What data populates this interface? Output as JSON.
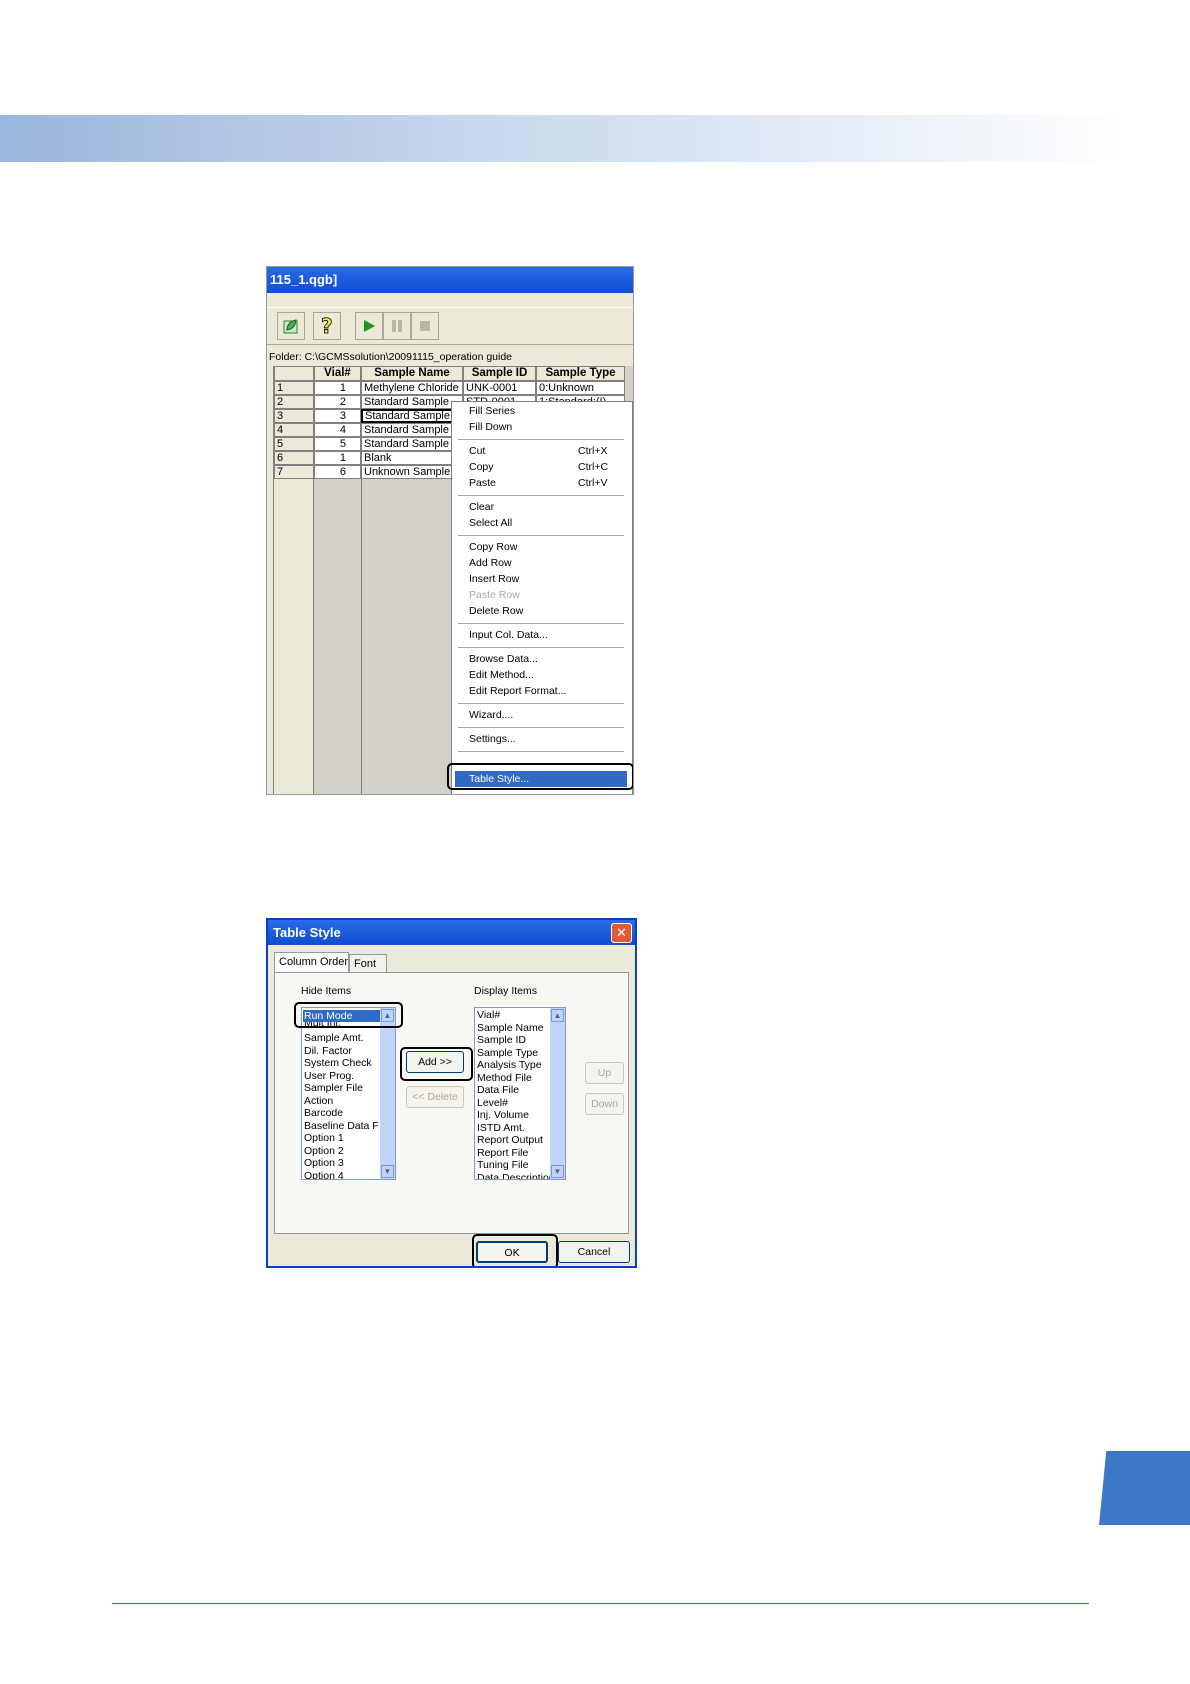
{
  "window": {
    "title": "115_1.qgb]",
    "folder": "Folder: C:\\GCMSsolution\\20091115_operation guide"
  },
  "toolbar": {
    "icons": [
      "leaf-icon",
      "help-icon",
      "play-icon",
      "pause-icon",
      "stop-icon"
    ]
  },
  "table": {
    "headers": [
      "",
      "Vial#",
      "Sample Name",
      "Sample ID",
      "Sample Type"
    ],
    "rows": [
      [
        "1",
        "1",
        "Methylene Chloride",
        "UNK-0001",
        "0:Unknown"
      ],
      [
        "2",
        "2",
        "Standard Sample",
        "STD-0001",
        "1:Standard:(I)"
      ],
      [
        "3",
        "3",
        "Standard Sample",
        "",
        ""
      ],
      [
        "4",
        "4",
        "Standard Sample",
        "",
        ""
      ],
      [
        "5",
        "5",
        "Standard Sample",
        "",
        ""
      ],
      [
        "6",
        "1",
        "Blank",
        "",
        ""
      ],
      [
        "7",
        "6",
        "Unknown Sample",
        "",
        ""
      ]
    ]
  },
  "context_menu": {
    "fill_series": "Fill Series",
    "fill_down": "Fill Down",
    "cut": "Cut",
    "cut_sc": "Ctrl+X",
    "copy": "Copy",
    "copy_sc": "Ctrl+C",
    "paste": "Paste",
    "paste_sc": "Ctrl+V",
    "clear": "Clear",
    "select_all": "Select All",
    "copy_row": "Copy Row",
    "add_row": "Add Row",
    "insert_row": "Insert Row",
    "paste_row": "Paste Row",
    "delete_row": "Delete Row",
    "input_col": "Input Col. Data...",
    "browse_data": "Browse Data...",
    "edit_method": "Edit Method...",
    "edit_report": "Edit Report Format...",
    "wizard": "Wizard....",
    "settings": "Settings...",
    "table_style": "Table Style..."
  },
  "dialog": {
    "title": "Table Style",
    "close": "✕",
    "tab_column_order": "Column Order",
    "tab_font": "Font",
    "hide_label": "Hide Items",
    "display_label": "Display Items",
    "hide_items": [
      "Run Mode",
      "Mult Inj.",
      "Sample Amt.",
      "Dil. Factor",
      "System Check",
      "User Prog.",
      "Sampler File",
      "Action",
      "Barcode",
      "Baseline Data F",
      "Option 1",
      "Option 2",
      "Option 3",
      "Option 4"
    ],
    "display_items": [
      "Vial#",
      "Sample Name",
      "Sample ID",
      "Sample Type",
      "Analysis Type",
      "Method File",
      "Data File",
      "Level#",
      "Inj. Volume",
      "ISTD Amt.",
      "Report Output",
      "Report File",
      "Tuning File",
      "Data Description"
    ],
    "add_button": "Add >>",
    "delete_button": "<< Delete",
    "up_button": "Up",
    "down_button": "Down",
    "ok_button": "OK",
    "cancel_button": "Cancel"
  }
}
